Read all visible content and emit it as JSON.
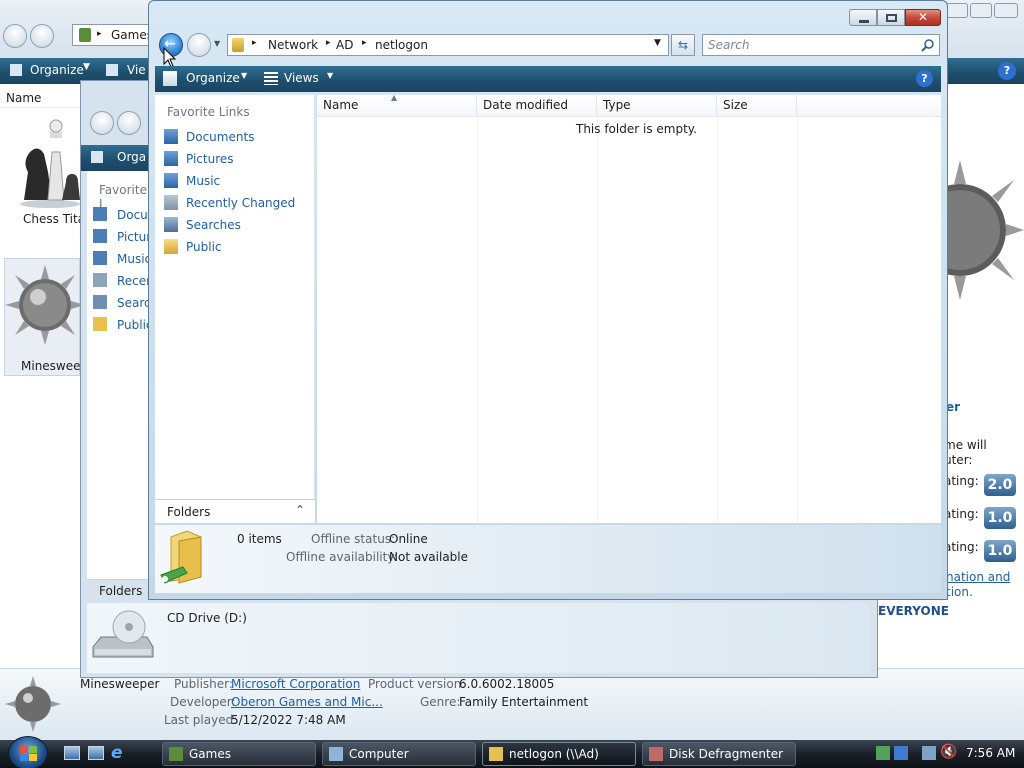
{
  "games_window": {
    "address": "Games",
    "toolbar": {
      "organize": "Organize",
      "views": "Vie"
    },
    "column_name": "Name",
    "items": [
      {
        "label": "Chess Tita",
        "icon": "chess-icon"
      },
      {
        "label": "Minesweep",
        "icon": "minesweeper-icon"
      }
    ],
    "right_panel": {
      "heading": "er",
      "line1": "me will",
      "line2": "uter:",
      "rating_label": "ating:",
      "ratings": [
        "2.0",
        "1.0",
        "1.0"
      ],
      "link_line1": "nation and",
      "link_line2": "tion.",
      "esrb": "EVERYONE"
    },
    "details": {
      "game_name": "Minesweeper",
      "publisher_label": "Publisher:",
      "publisher": "Microsoft Corporation",
      "developer_label": "Developer:",
      "developer": "Oberon Games and Mic...",
      "last_played_label": "Last played:",
      "last_played": "5/12/2022 7:48 AM",
      "product_version_label": "Product version:",
      "product_version": "6.0.6002.18005",
      "genre_label": "Genre:",
      "genre": "Family Entertainment"
    }
  },
  "computer_window": {
    "toolbar": {
      "organize": "Orga"
    },
    "favorite_links_title": "Favorite L",
    "links": [
      "Docu",
      "Pictur",
      "Music",
      "Recen",
      "Search",
      "Public"
    ],
    "folders_label": "Folders",
    "drive_label": "CD Drive (D:)"
  },
  "netlogon_window": {
    "breadcrumb": [
      "Network",
      "AD",
      "netlogon"
    ],
    "search_placeholder": "Search",
    "toolbar": {
      "organize": "Organize",
      "views": "Views"
    },
    "favorite_links_title": "Favorite Links",
    "links": [
      {
        "label": "Documents",
        "icon": "documents-icon"
      },
      {
        "label": "Pictures",
        "icon": "pictures-icon"
      },
      {
        "label": "Music",
        "icon": "music-icon"
      },
      {
        "label": "Recently Changed",
        "icon": "recently-changed-icon"
      },
      {
        "label": "Searches",
        "icon": "searches-icon"
      },
      {
        "label": "Public",
        "icon": "public-folder-icon"
      }
    ],
    "folders_label": "Folders",
    "columns": [
      "Name",
      "Date modified",
      "Type",
      "Size"
    ],
    "empty_message": "This folder is empty.",
    "status": {
      "items": "0 items",
      "offline_status_label": "Offline status:",
      "offline_status": "Online",
      "offline_availability_label": "Offline availability:",
      "offline_availability": "Not available"
    }
  },
  "taskbar": {
    "buttons": [
      "Games",
      "Computer",
      "netlogon (\\\\Ad)",
      "Disk Defragmenter"
    ],
    "clock": "7:56 AM"
  },
  "colors": {
    "link": "#1f5fa8",
    "toolbar": "#1f4f6e",
    "close_button": "#c74a3a",
    "taskbar": "#1a1f27"
  }
}
